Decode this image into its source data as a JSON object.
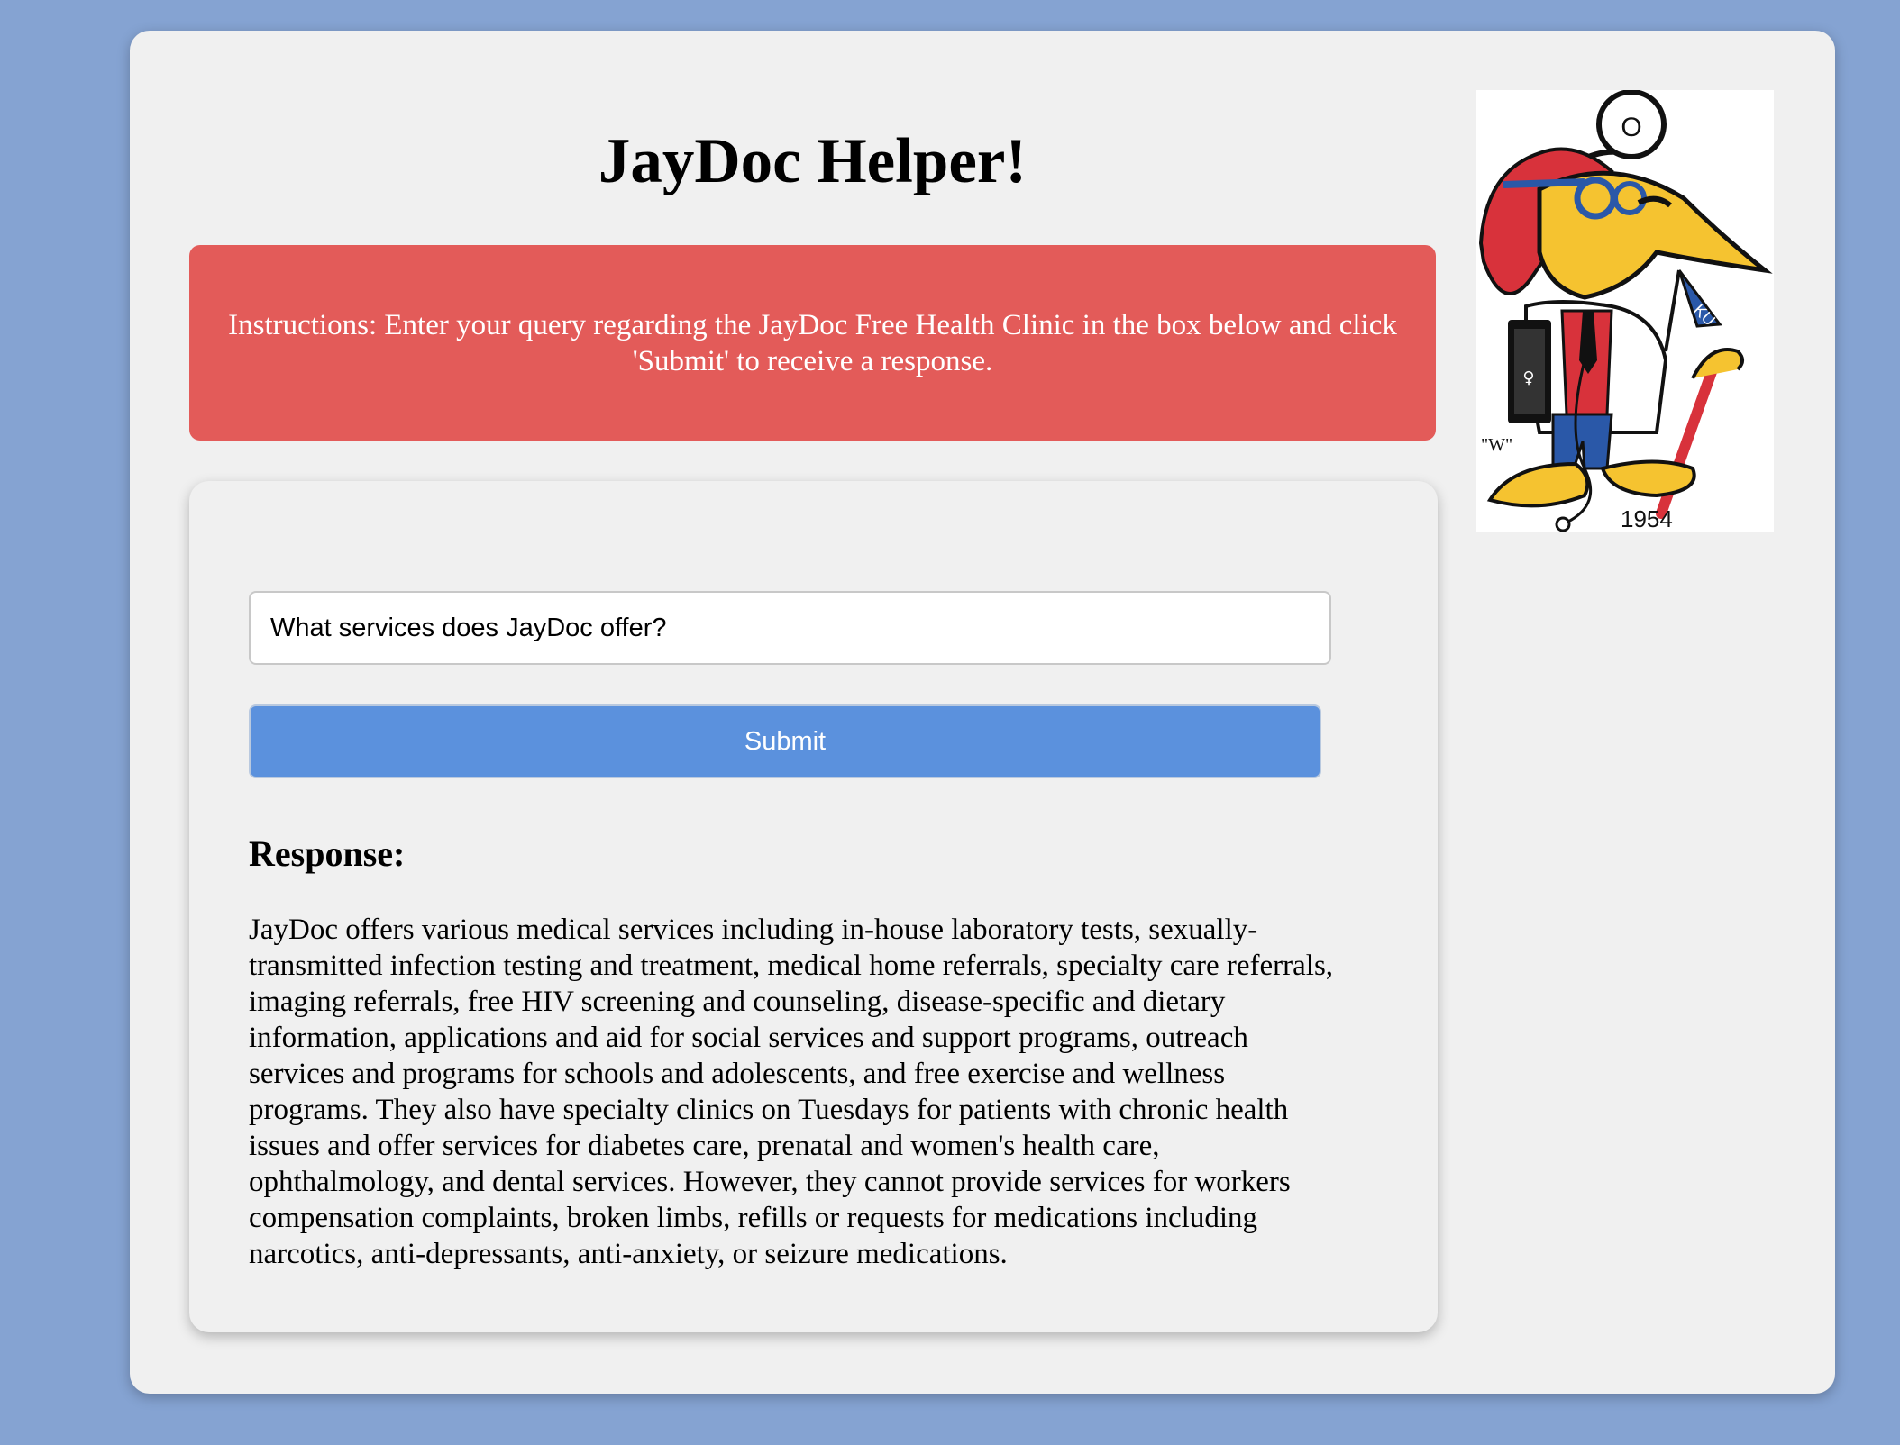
{
  "page": {
    "title": "JayDoc Helper!"
  },
  "instructions": {
    "text": "Instructions: Enter your query regarding the JayDoc Free Health Clinic in the box below and click 'Submit' to receive a response."
  },
  "form": {
    "query_value": "What services does JayDoc offer?",
    "submit_label": "Submit"
  },
  "response": {
    "heading": "Response:",
    "text": "JayDoc offers various medical services including in-house laboratory tests, sexually-transmitted infection testing and treatment, medical home referrals, specialty care referrals, imaging referrals, free HIV screening and counseling, disease-specific and dietary information, applications and aid for social services and support programs, outreach services and programs for schools and adolescents, and free exercise and wellness programs. They also have specialty clinics on Tuesdays for patients with chronic health issues and offer services for diabetes care, prenatal and women's health care, ophthalmology, and dental services. However, they cannot provide services for workers compensation complaints, broken limbs, refills or requests for medications including narcotics, anti-depressants, anti-anxiety, or seizure medications."
  },
  "mascot": {
    "year": "1954",
    "flag_text": "KU",
    "mirror_letter": "O",
    "signature": "\"W\""
  },
  "colors": {
    "background": "#85a3d2",
    "card": "#f0f0f0",
    "instructions_bg": "#e35b59",
    "button_bg": "#5b91dd"
  }
}
